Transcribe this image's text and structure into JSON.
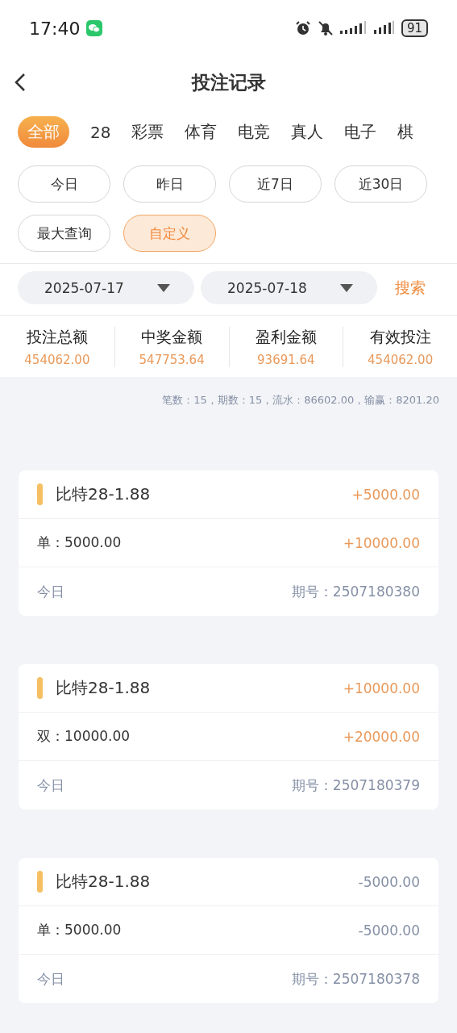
{
  "status_bar": {
    "time": "17:40",
    "battery": "91"
  },
  "header": {
    "title": "投注记录"
  },
  "tabs": [
    {
      "label": "全部",
      "selected": true
    },
    {
      "label": "28",
      "selected": false
    },
    {
      "label": "彩票",
      "selected": false
    },
    {
      "label": "体育",
      "selected": false
    },
    {
      "label": "电竞",
      "selected": false
    },
    {
      "label": "真人",
      "selected": false
    },
    {
      "label": "电子",
      "selected": false
    },
    {
      "label": "棋",
      "selected": false
    }
  ],
  "ranges": [
    {
      "label": "今日",
      "selected": false
    },
    {
      "label": "昨日",
      "selected": false
    },
    {
      "label": "近7日",
      "selected": false
    },
    {
      "label": "近30日",
      "selected": false
    },
    {
      "label": "最大查询",
      "selected": false
    },
    {
      "label": "自定义",
      "selected": true
    }
  ],
  "date_filter": {
    "start": "2025-07-17",
    "end": "2025-07-18",
    "search": "搜索"
  },
  "summary": [
    {
      "label": "投注总额",
      "value": "454062.00"
    },
    {
      "label": "中奖金额",
      "value": "547753.64"
    },
    {
      "label": "盈利金额",
      "value": "93691.64"
    },
    {
      "label": "有效投注",
      "value": "454062.00"
    }
  ],
  "stats": "笔数：15，期数：15，流水：86602.00，输赢：8201.20",
  "records": [
    {
      "name": "比特28-1.88",
      "kind": "gain",
      "profit": "+5000.00",
      "bet": "单：5000.00",
      "payout": "+10000.00",
      "day": "今日",
      "issue": "期号：2507180380"
    },
    {
      "name": "比特28-1.88",
      "kind": "gain",
      "profit": "+10000.00",
      "bet": "双：10000.00",
      "payout": "+20000.00",
      "day": "今日",
      "issue": "期号：2507180379"
    },
    {
      "name": "比特28-1.88",
      "kind": "loss",
      "profit": "-5000.00",
      "bet": "单：5000.00",
      "payout": "-5000.00",
      "day": "今日",
      "issue": "期号：2507180378"
    }
  ]
}
